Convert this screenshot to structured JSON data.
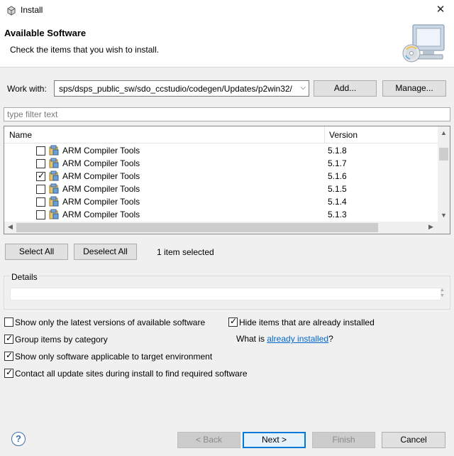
{
  "window": {
    "title": "Install",
    "icon": "eclipse-install-icon",
    "close_icon": "close-icon"
  },
  "header": {
    "title": "Available Software",
    "subtitle": "Check the items that you wish to install.",
    "icon": "computer-with-cd-icon"
  },
  "work_with": {
    "label": "Work with:",
    "value": "sps/dsps_public_sw/sdo_ccstudio/codegen/Updates/p2win32/",
    "add_label": "Add...",
    "manage_label": "Manage..."
  },
  "filter": {
    "placeholder": "type filter text",
    "value": ""
  },
  "table": {
    "columns": [
      "Name",
      "Version"
    ],
    "rows": [
      {
        "name": "ARM Compiler Tools",
        "version": "5.1.8",
        "checked": false
      },
      {
        "name": "ARM Compiler Tools",
        "version": "5.1.7",
        "checked": false
      },
      {
        "name": "ARM Compiler Tools",
        "version": "5.1.6",
        "checked": true
      },
      {
        "name": "ARM Compiler Tools",
        "version": "5.1.5",
        "checked": false
      },
      {
        "name": "ARM Compiler Tools",
        "version": "5.1.4",
        "checked": false
      },
      {
        "name": "ARM Compiler Tools",
        "version": "5.1.3",
        "checked": false
      }
    ]
  },
  "selection": {
    "select_all_label": "Select All",
    "deselect_all_label": "Deselect All",
    "status": "1 item selected"
  },
  "details": {
    "label": "Details",
    "value": ""
  },
  "options": {
    "latest_only": {
      "label": "Show only the latest versions of available software",
      "checked": false
    },
    "hide_installed": {
      "label": "Hide items that are already installed",
      "checked": true
    },
    "group_by_category": {
      "label": "Group items by category",
      "checked": true
    },
    "what_is_prefix": "What is ",
    "already_installed_link": "already installed",
    "what_is_suffix": "?",
    "target_env": {
      "label": "Show only software applicable to target environment",
      "checked": true
    },
    "contact_sites": {
      "label": "Contact all update sites during install to find required software",
      "checked": true
    }
  },
  "footer": {
    "help_label": "?",
    "back_label": "< Back",
    "next_label": "Next >",
    "finish_label": "Finish",
    "cancel_label": "Cancel"
  }
}
